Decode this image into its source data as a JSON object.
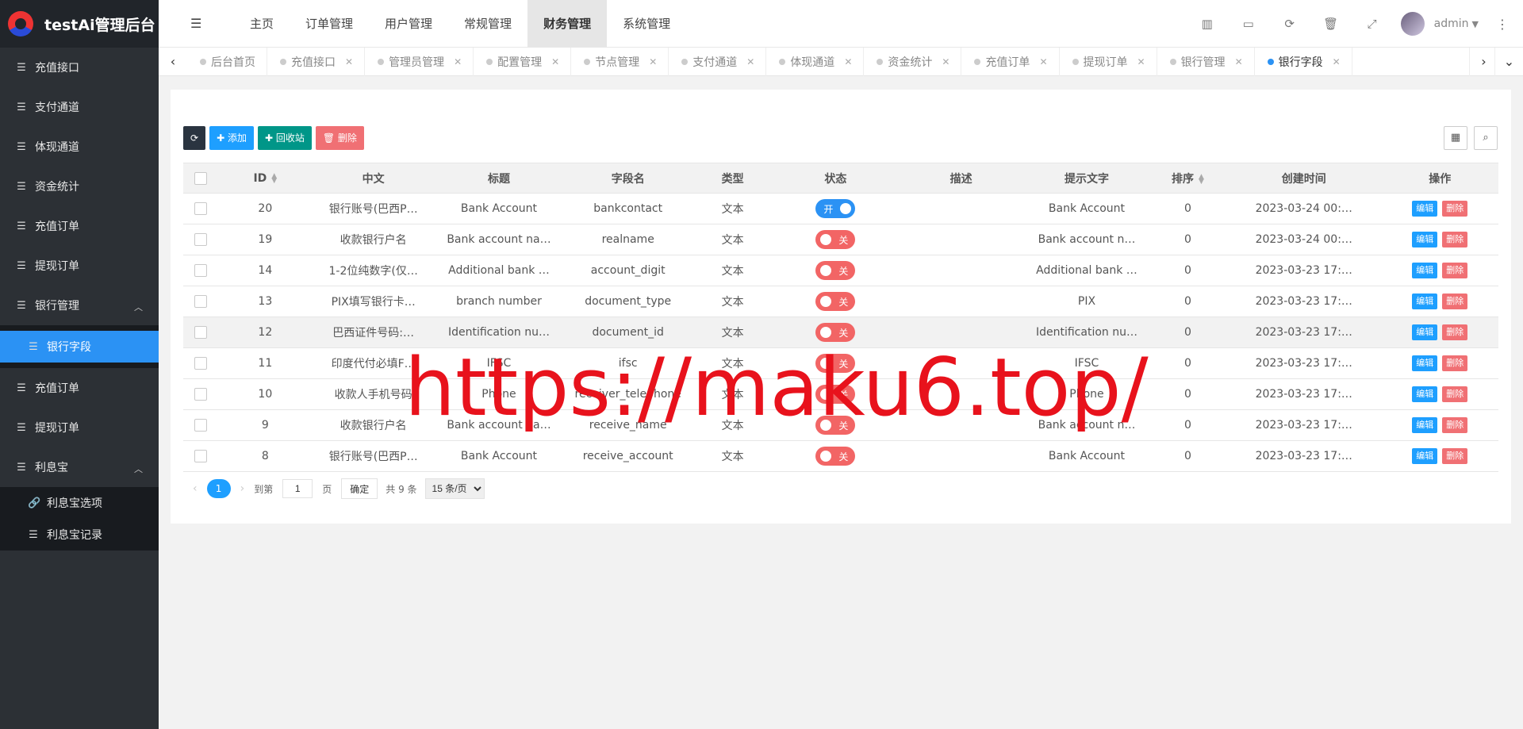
{
  "app": {
    "title": "testAi管理后台"
  },
  "sidebar": {
    "items": [
      {
        "label": "充值接口"
      },
      {
        "label": "支付通道"
      },
      {
        "label": "体现通道"
      },
      {
        "label": "资金统计"
      },
      {
        "label": "充值订单"
      },
      {
        "label": "提现订单"
      },
      {
        "label": "银行管理"
      }
    ],
    "bank_sub": {
      "label": "银行字段"
    },
    "items2": [
      {
        "label": "充值订单"
      },
      {
        "label": "提现订单"
      },
      {
        "label": "利息宝"
      }
    ],
    "lixi_sub": [
      {
        "label": "利息宝选项"
      },
      {
        "label": "利息宝记录"
      }
    ]
  },
  "nav": {
    "items": [
      {
        "label": "主页"
      },
      {
        "label": "订单管理"
      },
      {
        "label": "用户管理"
      },
      {
        "label": "常规管理"
      },
      {
        "label": "财务管理"
      },
      {
        "label": "系统管理"
      }
    ],
    "active": "财务管理"
  },
  "user": {
    "name": "admin"
  },
  "tabs": [
    {
      "label": "后台首页"
    },
    {
      "label": "充值接口"
    },
    {
      "label": "管理员管理"
    },
    {
      "label": "配置管理"
    },
    {
      "label": "节点管理"
    },
    {
      "label": "支付通道"
    },
    {
      "label": "体现通道"
    },
    {
      "label": "资金统计"
    },
    {
      "label": "充值订单"
    },
    {
      "label": "提现订单"
    },
    {
      "label": "银行管理"
    },
    {
      "label": "银行字段"
    }
  ],
  "toolbar": {
    "add": "添加",
    "recycle": "回收站",
    "delete": "删除"
  },
  "table": {
    "headers": [
      "ID",
      "中文",
      "标题",
      "字段名",
      "类型",
      "状态",
      "描述",
      "提示文字",
      "排序",
      "创建时间",
      "操作"
    ],
    "edit_label": "编辑",
    "delete_label": "删除",
    "rows": [
      {
        "id": "20",
        "zh": "银行账号(巴西P…",
        "title": "Bank Account",
        "field": "bankcontact",
        "type": "文本",
        "status": "开",
        "on": true,
        "desc": "",
        "hint": "Bank Account",
        "sort": "0",
        "created": "2023-03-24 00:…"
      },
      {
        "id": "19",
        "zh": "收款银行户名",
        "title": "Bank account na…",
        "field": "realname",
        "type": "文本",
        "status": "关",
        "on": false,
        "desc": "",
        "hint": "Bank account n…",
        "sort": "0",
        "created": "2023-03-24 00:…"
      },
      {
        "id": "14",
        "zh": "1-2位纯数字(仅…",
        "title": "Additional bank …",
        "field": "account_digit",
        "type": "文本",
        "status": "关",
        "on": false,
        "desc": "",
        "hint": "Additional bank …",
        "sort": "0",
        "created": "2023-03-23 17:…"
      },
      {
        "id": "13",
        "zh": "PIX填写银行卡…",
        "title": "branch number",
        "field": "document_type",
        "type": "文本",
        "status": "关",
        "on": false,
        "desc": "",
        "hint": "PIX",
        "sort": "0",
        "created": "2023-03-23 17:…"
      },
      {
        "id": "12",
        "zh": "巴西证件号码:…",
        "title": "Identification nu…",
        "field": "document_id",
        "type": "文本",
        "status": "关",
        "on": false,
        "desc": "",
        "hint": "Identification nu…",
        "sort": "0",
        "created": "2023-03-23 17:…"
      },
      {
        "id": "11",
        "zh": "印度代付必填F…",
        "title": "IFSC",
        "field": "ifsc",
        "type": "文本",
        "status": "关",
        "on": false,
        "desc": "",
        "hint": "IFSC",
        "sort": "0",
        "created": "2023-03-23 17:…"
      },
      {
        "id": "10",
        "zh": "收款人手机号码",
        "title": "Phone",
        "field": "receiver_telephone",
        "type": "文本",
        "status": "关",
        "on": false,
        "desc": "",
        "hint": "Phone",
        "sort": "0",
        "created": "2023-03-23 17:…"
      },
      {
        "id": "9",
        "zh": "收款银行户名",
        "title": "Bank account na…",
        "field": "receive_name",
        "type": "文本",
        "status": "关",
        "on": false,
        "desc": "",
        "hint": "Bank account n…",
        "sort": "0",
        "created": "2023-03-23 17:…"
      },
      {
        "id": "8",
        "zh": "银行账号(巴西P…",
        "title": "Bank Account",
        "field": "receive_account",
        "type": "文本",
        "status": "关",
        "on": false,
        "desc": "",
        "hint": "Bank Account",
        "sort": "0",
        "created": "2023-03-23 17:…"
      }
    ]
  },
  "pager": {
    "current": "1",
    "goto_label": "到第",
    "page_value": "1",
    "page_unit": "页",
    "confirm": "确定",
    "total": "共 9 条",
    "per_page": "15 条/页"
  },
  "watermark": "https://maku6.top/"
}
